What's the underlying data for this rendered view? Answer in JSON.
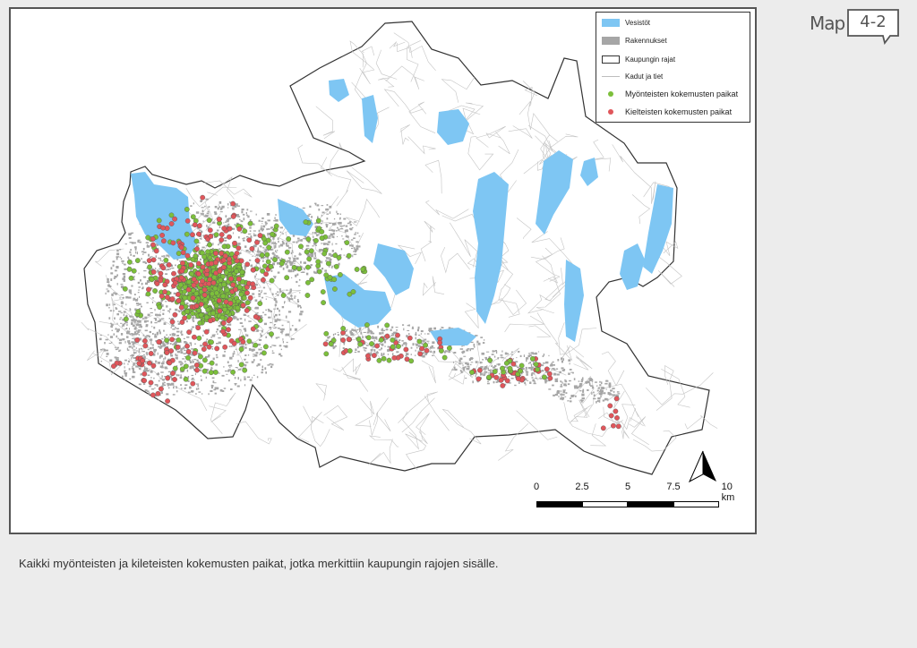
{
  "badge": {
    "title": "Map",
    "number": "4-2"
  },
  "legend": {
    "items": [
      {
        "label": "Vesistöt",
        "symbol": "fill",
        "color": "#7ec6f3",
        "icon": "water-swatch-icon"
      },
      {
        "label": "Rakennukset",
        "symbol": "fill",
        "color": "#a6a6a6",
        "icon": "building-swatch-icon"
      },
      {
        "label": "Kaupungin rajat",
        "symbol": "outline",
        "color": "#333333",
        "icon": "boundary-swatch-icon"
      },
      {
        "label": "Kadut ja tiet",
        "symbol": "line",
        "color": "#bdbdbd",
        "icon": "road-line-icon"
      },
      {
        "label": "Myönteisten kokemusten paikat",
        "symbol": "point",
        "color": "#7cbf3b",
        "icon": "green-point-icon"
      },
      {
        "label": "Kielteisten kokemusten paikat",
        "symbol": "point",
        "color": "#e0565b",
        "icon": "red-point-icon"
      }
    ]
  },
  "scale_bar": {
    "labels": [
      "0",
      "2.5",
      "5",
      "7.5",
      "10 km"
    ]
  },
  "caption": "Kaikki myönteisten ja kileteisten kokemusten paikat, jotka merkittiin kaupungin rajojen sisälle.",
  "colors": {
    "water": "#7ec6f3",
    "buildings": "#a6a6a6",
    "roads": "#c4c4c4",
    "boundary": "#333333",
    "positive": "#7cbf3b",
    "negative": "#e0565b"
  }
}
